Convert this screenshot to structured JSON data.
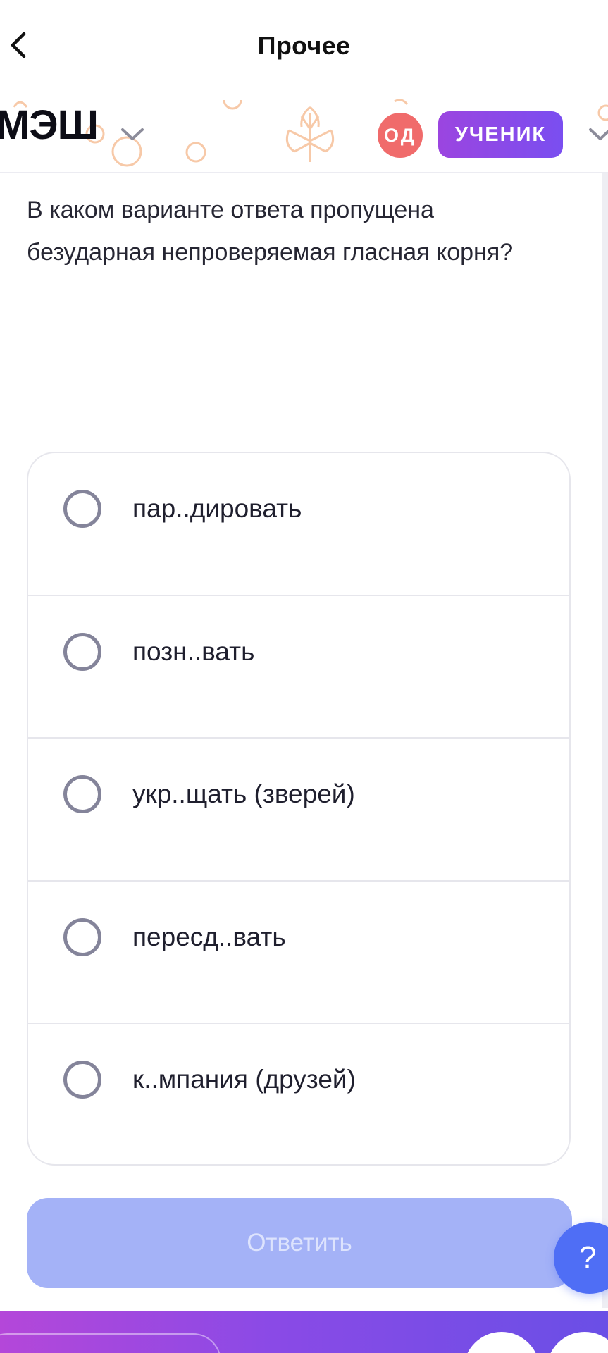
{
  "nav": {
    "title": "Прочее"
  },
  "header": {
    "logo": "МЭШ",
    "avatar_initials": "ОД",
    "role_label": "УЧЕНИК"
  },
  "question": {
    "text": "В каком варианте ответа пропущена безударная непроверяемая гласная корня?"
  },
  "options": [
    {
      "label": "пар..дировать",
      "selected": false
    },
    {
      "label": "позн..вать",
      "selected": false
    },
    {
      "label": "укр..щать (зверей)",
      "selected": false
    },
    {
      "label": "пересд..вать",
      "selected": false
    },
    {
      "label": "к..мпания (друзей)",
      "selected": false
    }
  ],
  "submit": {
    "label": "Ответить",
    "enabled": false
  },
  "help": {
    "label": "?"
  },
  "colors": {
    "brand_gradient_start": "#9b45e0",
    "brand_gradient_end": "#7a4ef0",
    "avatar_bg": "#f06b6b",
    "submit_disabled_bg": "#a4b2f7",
    "help_bg": "#4f6ef5",
    "decor_orange": "#f7c9a8"
  },
  "icons": {
    "back": "chevron-left-icon",
    "logo_menu": "chevron-down-icon",
    "role_menu": "chevron-down-icon",
    "radio": "radio-unchecked-icon"
  }
}
